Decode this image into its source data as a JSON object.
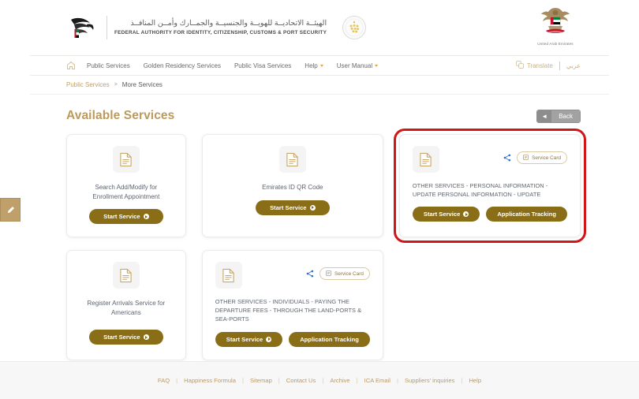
{
  "header": {
    "logo_arabic": "الهيئــة الاتحاديــة للهويــة والجنسيــة والجمــارك وأمــن المنافــذ",
    "logo_english": "FEDERAL AUTHORITY FOR IDENTITY, CITIZENSHIP, CUSTOMS & PORT SECURITY",
    "emblem_caption": "United Arab Emirates"
  },
  "nav": {
    "home_icon": "home-icon",
    "items": [
      {
        "label": "Public Services",
        "has_caret": false
      },
      {
        "label": "Golden Residency Services",
        "has_caret": false
      },
      {
        "label": "Public Visa Services",
        "has_caret": false
      },
      {
        "label": "Help",
        "has_caret": true
      },
      {
        "label": "User Manual",
        "has_caret": true
      }
    ],
    "translate_label": "Translate",
    "arabic_label": "عربي"
  },
  "breadcrumb": {
    "root": "Public Services",
    "separator": ">",
    "current": "More Services"
  },
  "title_row": {
    "title": "Available Services",
    "back_label": "Back",
    "back_arrow": "◄"
  },
  "labels": {
    "start_service": "Start Service",
    "application_tracking": "Application Tracking",
    "service_card": "Service Card"
  },
  "cards": [
    {
      "id": "search-add-modify-enrollment-appointment",
      "description": "Search Add/Modify for Enrollment Appointment",
      "layout": "centered",
      "has_service_card": false,
      "has_tracking": false,
      "highlighted": false
    },
    {
      "id": "emirates-id-qr-code",
      "description": "Emirates ID QR Code",
      "layout": "centered",
      "has_service_card": false,
      "has_tracking": false,
      "highlighted": false
    },
    {
      "id": "other-services-personal-information-update",
      "description": "OTHER SERVICES - PERSONAL INFORMATION - UPDATE PERSONAL INFORMATION - UPDATE",
      "layout": "left",
      "has_service_card": true,
      "has_tracking": true,
      "highlighted": true
    },
    {
      "id": "register-arrivals-service-for-americans",
      "description": "Register Arrivals Service for Americans",
      "layout": "centered",
      "has_service_card": false,
      "has_tracking": false,
      "highlighted": false
    },
    {
      "id": "other-services-individuals-paying-departure-fees",
      "description": "OTHER SERVICES - INDIVIDUALS - PAYING THE DEPARTURE FEES - THROUGH THE LAND-PORTS & SEA-PORTS",
      "layout": "left",
      "has_service_card": true,
      "has_tracking": true,
      "highlighted": false
    }
  ],
  "footer": {
    "links": [
      "FAQ",
      "Happiness Formula",
      "Sitemap",
      "Contact Us",
      "Archive",
      "ICA Email",
      "Suppliers' inquiries",
      "Help"
    ],
    "separator": "|"
  },
  "colors": {
    "accent_gold": "#bb9a5e",
    "button_gold": "#8a6d17",
    "highlight_red": "#d01717",
    "caret_orange": "#e8a33d"
  }
}
